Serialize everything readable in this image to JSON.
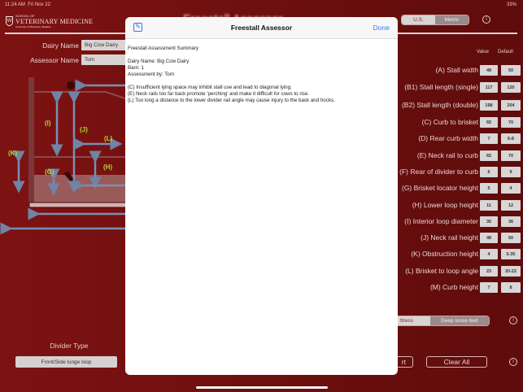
{
  "status_bar": {
    "time": "11:24 AM",
    "date": "Fri Nov 22",
    "battery": "33%"
  },
  "logo": {
    "line1": "SCHOOL OF",
    "line2": "VETERINARY MEDICINE",
    "line3": "University of Wisconsin–Madison"
  },
  "header": {
    "title": "Freestall Assessor",
    "units": {
      "options": [
        "U.S.",
        "Metric"
      ],
      "selected": "U.S."
    }
  },
  "form": {
    "dairy_name_label": "Dairy Name",
    "dairy_name_value": "Big Cow Dairy",
    "assessor_name_label": "Assessor Name",
    "assessor_name_value": "Tom"
  },
  "diagram_labels": [
    "(I)",
    "(J)",
    "(L)",
    "(K)",
    "(G)",
    "(H)"
  ],
  "measurements": {
    "value_header": "Value",
    "default_header": "Default",
    "rows": [
      {
        "label": "(A) Stall width",
        "value": "48",
        "default": "50"
      },
      {
        "label": "(B1) Stall length (single)",
        "value": "117",
        "default": "120"
      },
      {
        "label": "(B2) Stall length (double)",
        "value": "198",
        "default": "204"
      },
      {
        "label": "(C) Curb to brisket",
        "value": "65",
        "default": "70"
      },
      {
        "label": "(D) Rear curb width",
        "value": "7",
        "default": "6-8"
      },
      {
        "label": "(E) Neck rail to curb",
        "value": "65",
        "default": "70"
      },
      {
        "label": "(F) Rear of divider to curb",
        "value": "6",
        "default": "9"
      },
      {
        "label": "(G) Brisket locator height",
        "value": "5",
        "default": "4"
      },
      {
        "label": "(H) Lower loop height",
        "value": "11",
        "default": "12"
      },
      {
        "label": "(I) Interior loop diameter",
        "value": "35",
        "default": "36"
      },
      {
        "label": "(J) Neck rail height",
        "value": "48",
        "default": "50"
      },
      {
        "label": "(K) Obstruction height",
        "value": "4",
        "default": "5-35"
      },
      {
        "label": "(L) Brisket to loop angle",
        "value": "23",
        "default": "20-22"
      },
      {
        "label": "(M) Curb height",
        "value": "7",
        "default": "8"
      }
    ]
  },
  "bedding": {
    "options": [
      "ttress",
      "Deep loose bed"
    ],
    "selected": "ttress"
  },
  "divider": {
    "label": "Divider Type",
    "value": "Front/Side lunge loop"
  },
  "actions": {
    "report": "rt",
    "clear_all": "Clear All"
  },
  "modal": {
    "title": "Freestall Assessor",
    "done": "Done",
    "lines": [
      "Freestall Assessment Summary",
      "",
      "Dairy Name: Big Cow Dairy",
      "Barn: 1",
      "Assessment by: Tom",
      "",
      "(C) Insufficient lying space may inhibit stall use and lead to diagonal lying.",
      "(E) Neck rails too far back promote 'perching' and make it difficult for cows to rise.",
      "(L) Too long a distance to the lower divider rail angle may cause injury to the back and hocks."
    ]
  },
  "colors": {
    "background": "#6e0f0f",
    "accent": "#3478f6",
    "diagram_label": "#b8d430"
  }
}
